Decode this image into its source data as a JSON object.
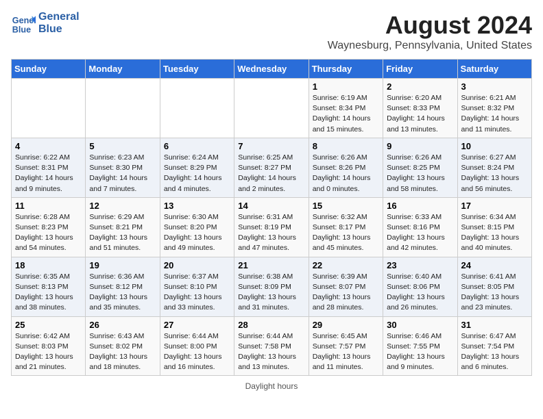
{
  "header": {
    "logo_line1": "General",
    "logo_line2": "Blue",
    "title": "August 2024",
    "subtitle": "Waynesburg, Pennsylvania, United States"
  },
  "days_of_week": [
    "Sunday",
    "Monday",
    "Tuesday",
    "Wednesday",
    "Thursday",
    "Friday",
    "Saturday"
  ],
  "weeks": [
    [
      {
        "day": "",
        "info": ""
      },
      {
        "day": "",
        "info": ""
      },
      {
        "day": "",
        "info": ""
      },
      {
        "day": "",
        "info": ""
      },
      {
        "day": "1",
        "info": "Sunrise: 6:19 AM\nSunset: 8:34 PM\nDaylight: 14 hours\nand 15 minutes."
      },
      {
        "day": "2",
        "info": "Sunrise: 6:20 AM\nSunset: 8:33 PM\nDaylight: 14 hours\nand 13 minutes."
      },
      {
        "day": "3",
        "info": "Sunrise: 6:21 AM\nSunset: 8:32 PM\nDaylight: 14 hours\nand 11 minutes."
      }
    ],
    [
      {
        "day": "4",
        "info": "Sunrise: 6:22 AM\nSunset: 8:31 PM\nDaylight: 14 hours\nand 9 minutes."
      },
      {
        "day": "5",
        "info": "Sunrise: 6:23 AM\nSunset: 8:30 PM\nDaylight: 14 hours\nand 7 minutes."
      },
      {
        "day": "6",
        "info": "Sunrise: 6:24 AM\nSunset: 8:29 PM\nDaylight: 14 hours\nand 4 minutes."
      },
      {
        "day": "7",
        "info": "Sunrise: 6:25 AM\nSunset: 8:27 PM\nDaylight: 14 hours\nand 2 minutes."
      },
      {
        "day": "8",
        "info": "Sunrise: 6:26 AM\nSunset: 8:26 PM\nDaylight: 14 hours\nand 0 minutes."
      },
      {
        "day": "9",
        "info": "Sunrise: 6:26 AM\nSunset: 8:25 PM\nDaylight: 13 hours\nand 58 minutes."
      },
      {
        "day": "10",
        "info": "Sunrise: 6:27 AM\nSunset: 8:24 PM\nDaylight: 13 hours\nand 56 minutes."
      }
    ],
    [
      {
        "day": "11",
        "info": "Sunrise: 6:28 AM\nSunset: 8:23 PM\nDaylight: 13 hours\nand 54 minutes."
      },
      {
        "day": "12",
        "info": "Sunrise: 6:29 AM\nSunset: 8:21 PM\nDaylight: 13 hours\nand 51 minutes."
      },
      {
        "day": "13",
        "info": "Sunrise: 6:30 AM\nSunset: 8:20 PM\nDaylight: 13 hours\nand 49 minutes."
      },
      {
        "day": "14",
        "info": "Sunrise: 6:31 AM\nSunset: 8:19 PM\nDaylight: 13 hours\nand 47 minutes."
      },
      {
        "day": "15",
        "info": "Sunrise: 6:32 AM\nSunset: 8:17 PM\nDaylight: 13 hours\nand 45 minutes."
      },
      {
        "day": "16",
        "info": "Sunrise: 6:33 AM\nSunset: 8:16 PM\nDaylight: 13 hours\nand 42 minutes."
      },
      {
        "day": "17",
        "info": "Sunrise: 6:34 AM\nSunset: 8:15 PM\nDaylight: 13 hours\nand 40 minutes."
      }
    ],
    [
      {
        "day": "18",
        "info": "Sunrise: 6:35 AM\nSunset: 8:13 PM\nDaylight: 13 hours\nand 38 minutes."
      },
      {
        "day": "19",
        "info": "Sunrise: 6:36 AM\nSunset: 8:12 PM\nDaylight: 13 hours\nand 35 minutes."
      },
      {
        "day": "20",
        "info": "Sunrise: 6:37 AM\nSunset: 8:10 PM\nDaylight: 13 hours\nand 33 minutes."
      },
      {
        "day": "21",
        "info": "Sunrise: 6:38 AM\nSunset: 8:09 PM\nDaylight: 13 hours\nand 31 minutes."
      },
      {
        "day": "22",
        "info": "Sunrise: 6:39 AM\nSunset: 8:07 PM\nDaylight: 13 hours\nand 28 minutes."
      },
      {
        "day": "23",
        "info": "Sunrise: 6:40 AM\nSunset: 8:06 PM\nDaylight: 13 hours\nand 26 minutes."
      },
      {
        "day": "24",
        "info": "Sunrise: 6:41 AM\nSunset: 8:05 PM\nDaylight: 13 hours\nand 23 minutes."
      }
    ],
    [
      {
        "day": "25",
        "info": "Sunrise: 6:42 AM\nSunset: 8:03 PM\nDaylight: 13 hours\nand 21 minutes."
      },
      {
        "day": "26",
        "info": "Sunrise: 6:43 AM\nSunset: 8:02 PM\nDaylight: 13 hours\nand 18 minutes."
      },
      {
        "day": "27",
        "info": "Sunrise: 6:44 AM\nSunset: 8:00 PM\nDaylight: 13 hours\nand 16 minutes."
      },
      {
        "day": "28",
        "info": "Sunrise: 6:44 AM\nSunset: 7:58 PM\nDaylight: 13 hours\nand 13 minutes."
      },
      {
        "day": "29",
        "info": "Sunrise: 6:45 AM\nSunset: 7:57 PM\nDaylight: 13 hours\nand 11 minutes."
      },
      {
        "day": "30",
        "info": "Sunrise: 6:46 AM\nSunset: 7:55 PM\nDaylight: 13 hours\nand 9 minutes."
      },
      {
        "day": "31",
        "info": "Sunrise: 6:47 AM\nSunset: 7:54 PM\nDaylight: 13 hours\nand 6 minutes."
      }
    ]
  ],
  "footer": {
    "label": "Daylight hours"
  }
}
